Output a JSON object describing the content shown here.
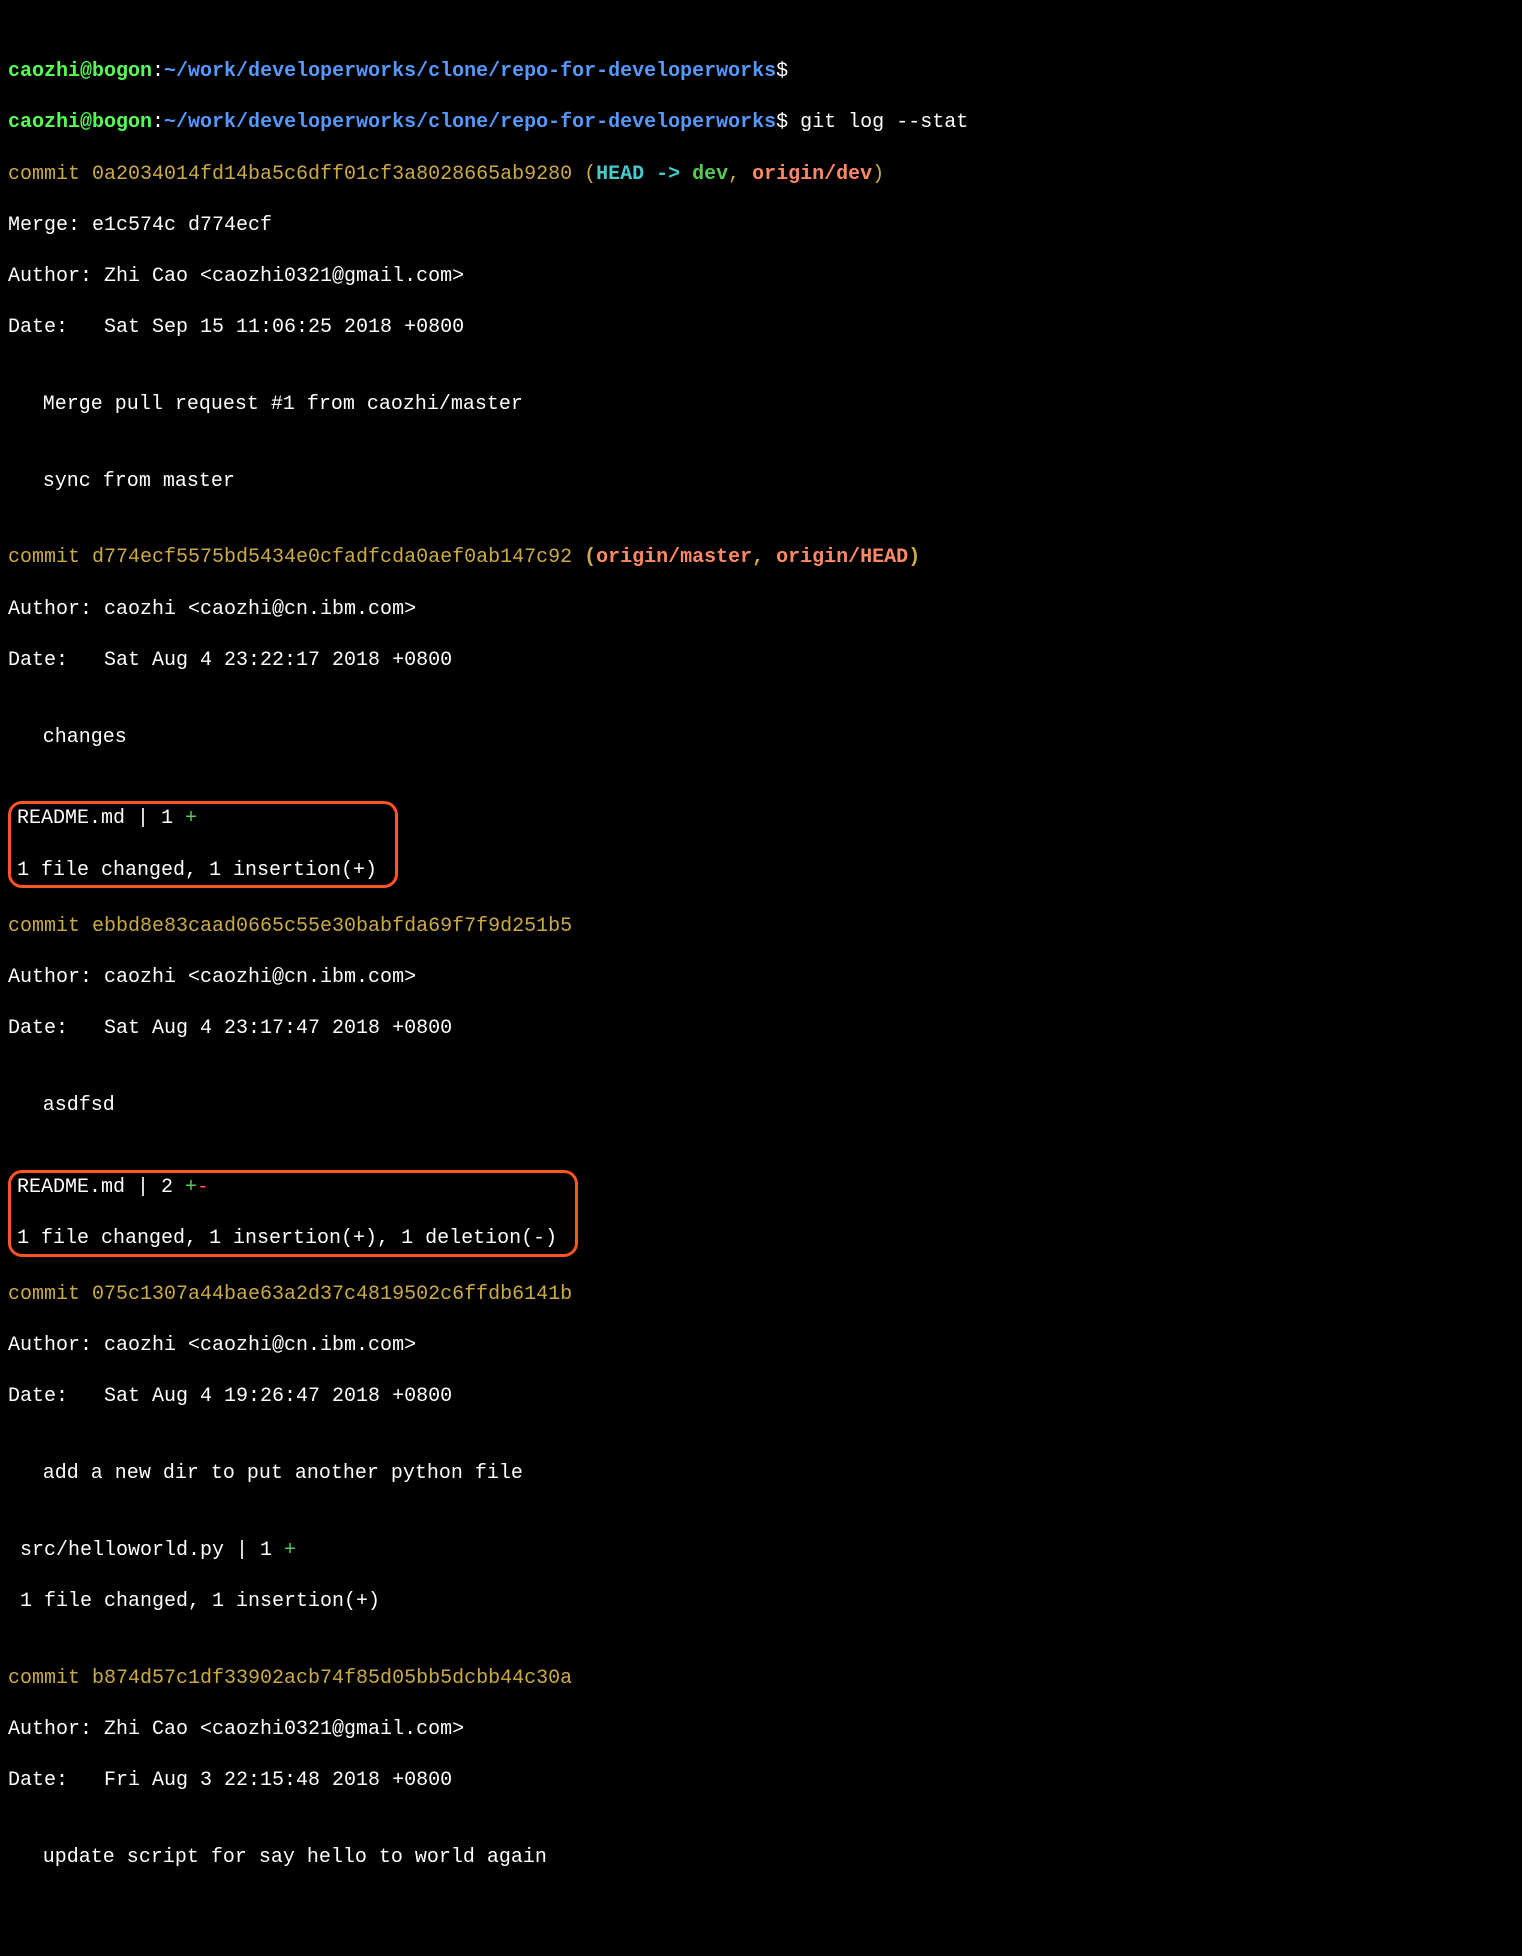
{
  "prompt": {
    "user": "caozhi@bogon",
    "colon": ":",
    "path": "~/work/developerworks/clone/repo-for-developerworks",
    "dollar": "$"
  },
  "cmd": " git log --stat",
  "c1": {
    "commit": "commit 0a2034014fd14ba5c6dff01cf3a8028665ab9280 ",
    "p1": "(",
    "head": "HEAD -> ",
    "dev": "dev",
    "c1": ", ",
    "origin_dev": "origin/dev",
    "p2": ")",
    "merge": "Merge: e1c574c d774ecf",
    "author": "Author: Zhi Cao <caozhi0321@gmail.com>",
    "date": "Date:   Sat Sep 15 11:06:25 2018 +0800",
    "msg1": "Merge pull request #1 from caozhi/master",
    "msg2": "sync from master"
  },
  "c2": {
    "commit": "commit d774ecf5575bd5434e0cfadfcda0aef0ab147c92 ",
    "p1": "(",
    "ref1": "origin/master",
    "c1": ", ",
    "ref2": "origin/HEAD",
    "p2": ")",
    "author": "Author: caozhi <caozhi@cn.ibm.com>",
    "date": "Date:   Sat Aug 4 23:22:17 2018 +0800",
    "msg": "changes",
    "stat1": "README.md | 1 ",
    "plus": "+",
    "stat2": "1 file changed, 1 insertion(+)"
  },
  "c3": {
    "commit": "commit ebbd8e83caad0665c55e30babfda69f7f9d251b5",
    "author": "Author: caozhi <caozhi@cn.ibm.com>",
    "date": "Date:   Sat Aug 4 23:17:47 2018 +0800",
    "msg": "asdfsd",
    "stat1": "README.md | 2 ",
    "plus": "+",
    "minus": "-",
    "stat2": "1 file changed, 1 insertion(+), 1 deletion(-)"
  },
  "c4": {
    "commit": "commit 075c1307a44bae63a2d37c4819502c6ffdb6141b",
    "author": "Author: caozhi <caozhi@cn.ibm.com>",
    "date": "Date:   Sat Aug 4 19:26:47 2018 +0800",
    "msg": "add a new dir to put another python file",
    "stat1": " src/helloworld.py | 1 ",
    "plus": "+",
    "stat2": " 1 file changed, 1 insertion(+)"
  },
  "c5": {
    "commit": "commit b874d57c1df33902acb74f85d05bb5dcbb44c30a",
    "author": "Author: Zhi Cao <caozhi0321@gmail.com>",
    "date": "Date:   Fri Aug 3 22:15:48 2018 +0800",
    "msg": "update script for say hello to world again"
  }
}
